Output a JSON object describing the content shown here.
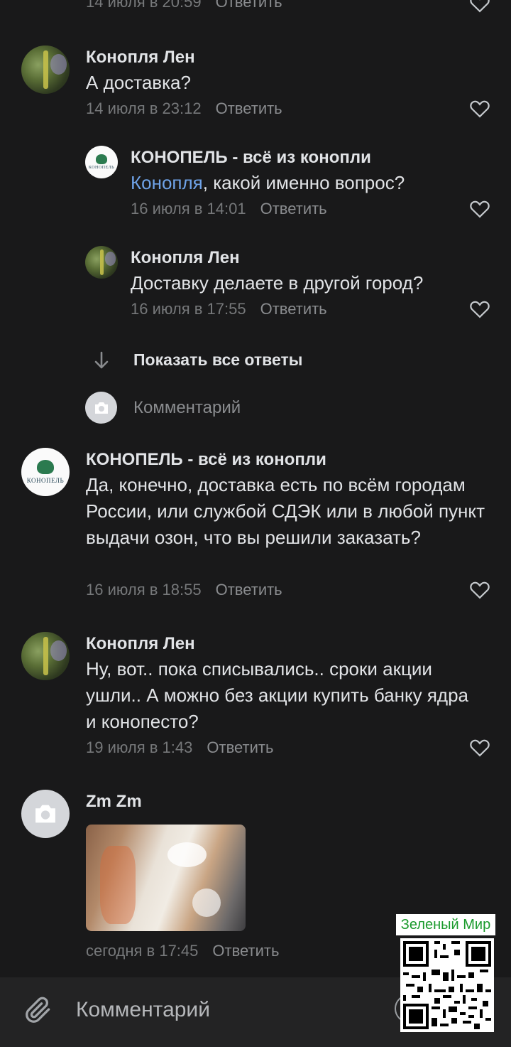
{
  "top_partial": {
    "time": "14 июля в 20:59",
    "reply": "Ответить"
  },
  "comments": [
    {
      "author": "Конопля Лен",
      "text": "А доставка?",
      "time": "14 июля в 23:12",
      "reply": "Ответить"
    },
    {
      "author": "КОНОПЕЛЬ - всё из конопли",
      "mention": "Конопля",
      "text": ", какой именно вопрос?",
      "time": "16 июля в 14:01",
      "reply": "Ответить"
    },
    {
      "author": "Конопля Лен",
      "text": "Доставку делаете в другой город?",
      "time": "16 июля в 17:55",
      "reply": "Ответить"
    },
    {
      "author": "КОНОПЕЛЬ - всё из конопли",
      "text": "Да, конечно, доставка есть по всём городам России, или службой СДЭК или в любой пункт выдачи озон, что вы решили заказать?",
      "time": "16 июля в 18:55",
      "reply": "Ответить"
    },
    {
      "author": "Конопля Лен",
      "text": "Ну, вот.. пока списывались.. сроки акции ушли.. А можно без акции купить банку ядра и конопесто?",
      "time": "19 июля в 1:43",
      "reply": "Ответить"
    },
    {
      "author": "Zm Zm",
      "time": "сегодня в 17:45",
      "reply": "Ответить"
    }
  ],
  "show_all_replies": "Показать все ответы",
  "reply_input_placeholder": "Комментарий",
  "avatar_brand_word": "КОНОПЕЛЬ",
  "bottom_input_placeholder": "Комментарий",
  "watermark": "Зеленый Мир",
  "icons": [
    "heart-icon",
    "arrow-down-icon",
    "camera-icon",
    "paperclip-icon",
    "qr-code"
  ],
  "colors": {
    "background": "#19191a",
    "mention": "#6fa3e8",
    "meta": "#76787a",
    "watermark_text": "#1a9a2c"
  }
}
